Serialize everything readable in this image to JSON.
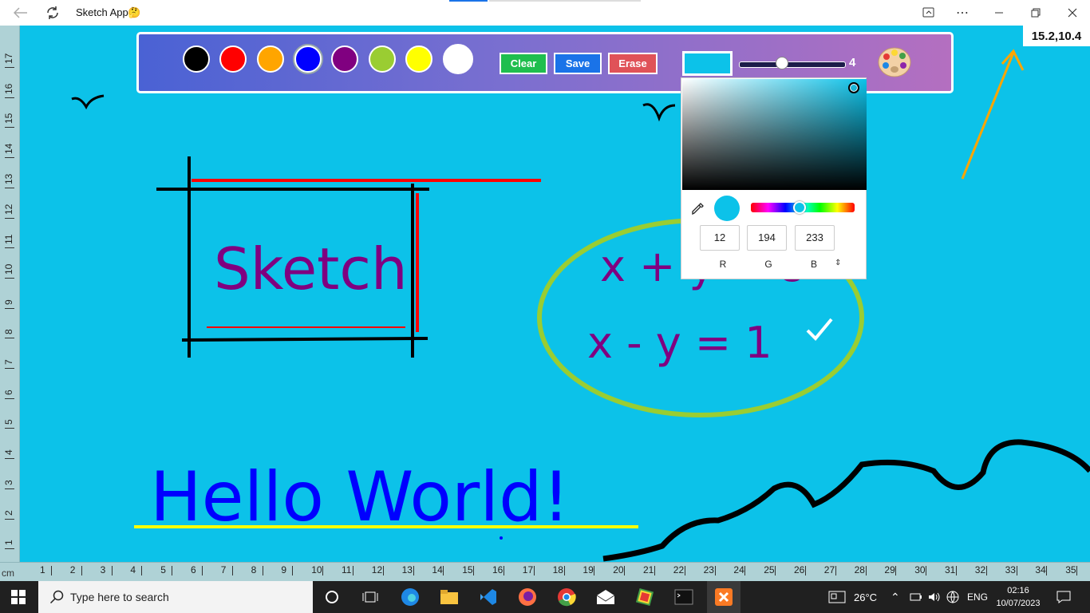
{
  "window": {
    "title": "Sketch App",
    "emoji": "🤔"
  },
  "coordinates": "15.2,10.4",
  "toolbar": {
    "swatches": [
      {
        "name": "black",
        "color": "#000000"
      },
      {
        "name": "red",
        "color": "#ff0000"
      },
      {
        "name": "orange",
        "color": "#ffa500"
      },
      {
        "name": "blue",
        "color": "#0000ff"
      },
      {
        "name": "purple",
        "color": "#800080"
      },
      {
        "name": "yellowgreen",
        "color": "#9acd32"
      },
      {
        "name": "yellow",
        "color": "#ffff00"
      },
      {
        "name": "white",
        "color": "#ffffff"
      }
    ],
    "clear_label": "Clear",
    "save_label": "Save",
    "erase_label": "Erase",
    "button_colors": {
      "clear": "#1fbe4e",
      "save": "#1a73e8",
      "erase": "#e05258"
    },
    "brush_size": "4",
    "brush_size_fraction": 0.42,
    "current_color": "#0cc2e9",
    "palette_icon": "palette-icon"
  },
  "color_picker": {
    "r": "12",
    "g": "194",
    "b": "233",
    "r_label": "R",
    "g_label": "G",
    "b_label": "B",
    "eyedropper_icon": "eyedropper-icon"
  },
  "canvas": {
    "background": "#0cc2e9",
    "unit_label": "cm",
    "ruler_h": [
      "1",
      "2",
      "3",
      "4",
      "5",
      "6",
      "7",
      "8",
      "9",
      "10",
      "11",
      "12",
      "13",
      "14",
      "15",
      "16",
      "17",
      "18",
      "19",
      "20",
      "21",
      "22",
      "23",
      "24",
      "25",
      "26",
      "27",
      "28",
      "29",
      "30",
      "31",
      "32",
      "33",
      "34",
      "35"
    ],
    "ruler_v": [
      "17",
      "16",
      "15",
      "14",
      "13",
      "12",
      "11",
      "10",
      "9",
      "8",
      "7",
      "6",
      "5",
      "4",
      "3",
      "2",
      "1"
    ],
    "drawings": {
      "sketch_text": "Sketch",
      "hello_text": "Hello World!",
      "eq1": "x + y = 8",
      "eq2": "x - y = 1"
    }
  },
  "taskbar": {
    "search_placeholder": "Type here to search",
    "weather": "26°C",
    "language": "ENG",
    "time": "02:16",
    "date": "10/07/2023"
  }
}
